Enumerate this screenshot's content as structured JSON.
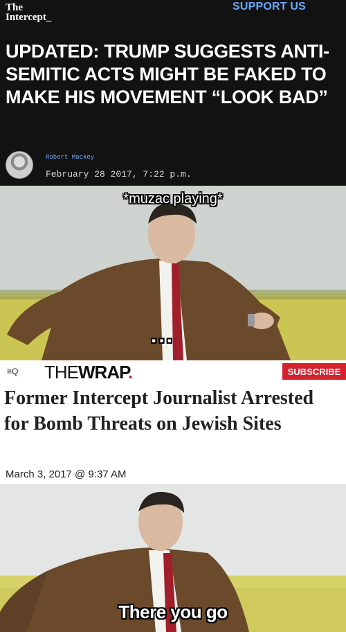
{
  "intercept": {
    "logo_line1": "The",
    "logo_line2": "Intercept_",
    "support_label": "SUPPORT US",
    "headline": "UPDATED: TRUMP SUGGESTS ANTI-SEMITIC ACTS MIGHT BE FAKED TO MAKE HIS MOVEMENT “LOOK BAD”",
    "author": "Robert Mackey",
    "date": "February 28 2017, 7:22 p.m."
  },
  "meme1": {
    "top_caption": "*muzac playing*",
    "bottom_caption": "..."
  },
  "thewrap": {
    "menu_icon": "menu-search-icon",
    "menu_glyph": "≡Q",
    "logo_the": "THE",
    "logo_wrap": "WRAP",
    "logo_dot": ".",
    "subscribe_label": "SUBSCRIBE",
    "headline": "Former Intercept Journalist Arrested for Bomb Threats on Jewish Sites",
    "date": "March 3, 2017 @ 9:37 AM"
  },
  "meme2": {
    "caption": "There you go"
  },
  "colors": {
    "support_blue": "#6aa8ff",
    "wrap_red": "#d4232f"
  }
}
